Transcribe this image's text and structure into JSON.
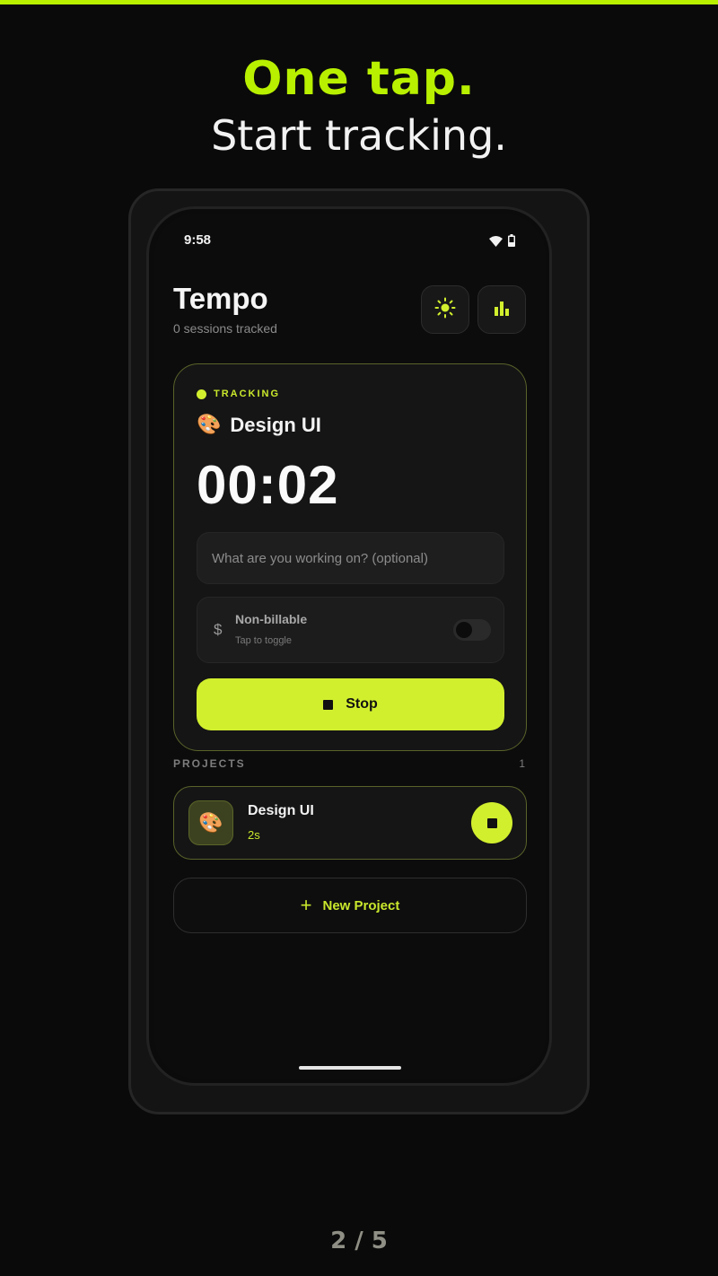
{
  "colors": {
    "accent": "#d2ef2e",
    "headline_accent": "#b8f000",
    "background": "#0a0a0a"
  },
  "promo": {
    "headline": "One tap.",
    "subheadline": "Start tracking.",
    "pager": "2 / 5"
  },
  "status_bar": {
    "time": "9:58",
    "icons": [
      "wifi-icon",
      "battery-icon"
    ]
  },
  "header": {
    "title": "Tempo",
    "subtitle": "0 sessions tracked",
    "buttons": [
      "theme-toggle-sun-icon",
      "stats-bar-chart-icon"
    ]
  },
  "tracking_card": {
    "status_label": "TRACKING",
    "project_emoji": "🎨",
    "project_name": "Design UI",
    "timer": "00:02",
    "note_placeholder": "What are you working on? (optional)",
    "note_value": "",
    "billable": {
      "icon": "$",
      "title": "Non-billable",
      "hint": "Tap to toggle",
      "enabled": false
    },
    "stop_label": "Stop"
  },
  "projects": {
    "section_title": "PROJECTS",
    "count": "1",
    "items": [
      {
        "emoji": "🎨",
        "name": "Design UI",
        "time": "2s",
        "active": true
      }
    ],
    "new_project_label": "New Project",
    "new_project_icon": "+"
  }
}
